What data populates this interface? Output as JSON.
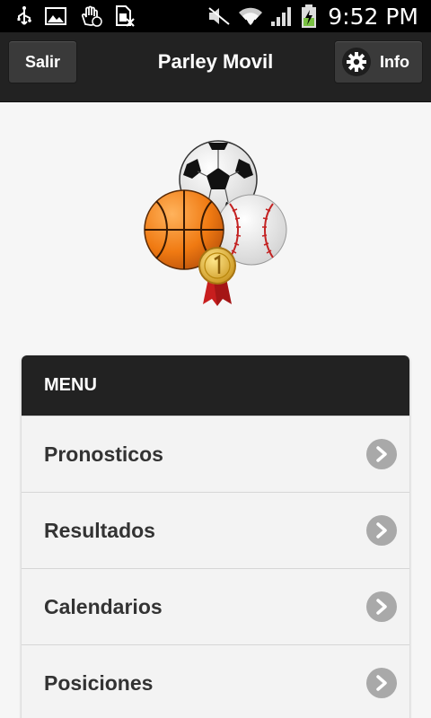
{
  "status_bar": {
    "time": "9:52 PM",
    "icons": [
      "usb-icon",
      "image-icon",
      "hand-icon",
      "sim-icon",
      "mute-icon",
      "wifi-icon",
      "signal-icon",
      "battery-charging-icon"
    ]
  },
  "header": {
    "title": "Parley Movil",
    "left_button": "Salir",
    "right_button": "Info",
    "right_button_icon": "gear-icon"
  },
  "logo": {
    "icons": [
      "soccer-ball",
      "basketball",
      "baseball",
      "gold-medal"
    ]
  },
  "menu": {
    "title": "MENU",
    "items": [
      {
        "label": "Pronosticos"
      },
      {
        "label": "Resultados"
      },
      {
        "label": "Calendarios"
      },
      {
        "label": "Posiciones"
      }
    ]
  },
  "colors": {
    "header_bg": "#222222",
    "page_bg": "#f6f6f6",
    "menu_item_bg": "#f3f3f3",
    "chevron_bg": "#a9a9a9"
  }
}
